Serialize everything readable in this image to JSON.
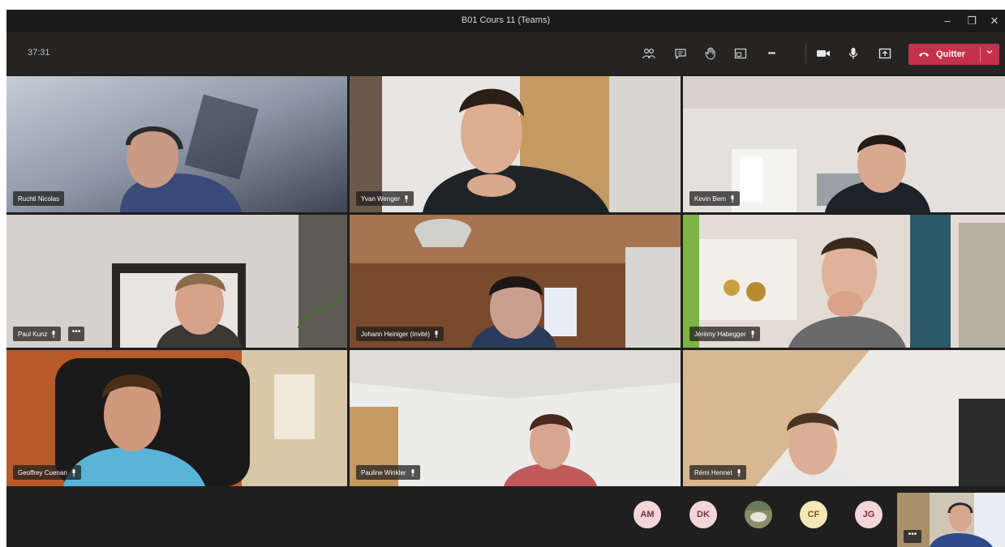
{
  "window": {
    "title": "B01 Cours 11 (Teams)",
    "controls": {
      "minimize": "–",
      "maximize": "❐",
      "close": "✕"
    }
  },
  "toolbar": {
    "timer": "37:31",
    "icons": [
      "people-icon",
      "chat-icon",
      "raise-hand-icon",
      "rooms-icon",
      "more-icon",
      "camera-icon",
      "mic-icon",
      "share-icon"
    ],
    "more_label": "•••",
    "leave_label": "Quitter",
    "leave_color": "#c4314b"
  },
  "participants": [
    {
      "name": "Ruchti Nicolas",
      "mic": false
    },
    {
      "name": "Yvan Wenger",
      "mic": true
    },
    {
      "name": "Kevin Bern",
      "mic": true
    },
    {
      "name": "Paul Kunz",
      "mic": true,
      "more": "•••"
    },
    {
      "name": "Johann Heiniger (Invité)",
      "mic": true
    },
    {
      "name": "Jérémy Habegger",
      "mic": true
    },
    {
      "name": "Geoffrey Cuenan",
      "mic": true
    },
    {
      "name": "Pauline Winkler",
      "mic": true
    },
    {
      "name": "Rémi Hennet",
      "mic": true
    }
  ],
  "footer": {
    "avatars": [
      {
        "initials": "AM",
        "bg": "#f3d6d8",
        "fg": "#7a2d3a"
      },
      {
        "initials": "DK",
        "bg": "#f3d6d8",
        "fg": "#7a2d3a"
      },
      {
        "initials": "",
        "bg": "#8a8f6a",
        "fg": "#ffffff",
        "photo": true
      },
      {
        "initials": "CF",
        "bg": "#f6e7b8",
        "fg": "#7a5b12"
      },
      {
        "initials": "JG",
        "bg": "#f3d6d8",
        "fg": "#7a2d3a"
      }
    ],
    "self_more": "•••"
  }
}
